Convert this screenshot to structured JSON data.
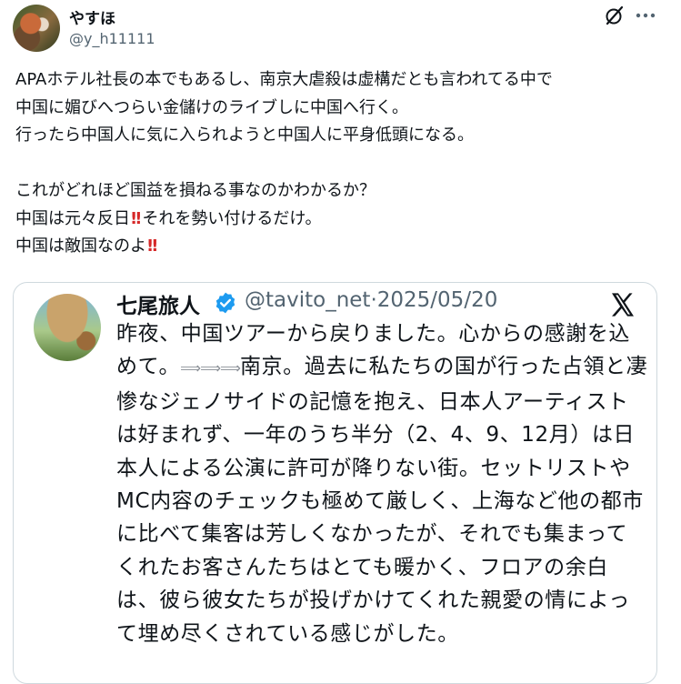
{
  "post": {
    "author_name": "やすほ",
    "author_handle": "@y_h11111",
    "text_line1": "APAホテル社長の本でもあるし、南京大虐殺は虚構だとも言われてる中で",
    "text_line2": "中国に媚びへつらい金儲けのライブしに中国へ行く。",
    "text_line3": "行ったら中国人に気に入られようと中国人に平身低頭になる。",
    "text_line4": "これがどれほど国益を損ねる事なのかわかるか？",
    "text_line5a": "中国は元々反日",
    "text_line5b": "それを勢い付けるだけ。",
    "text_line6": "中国は敵国なのよ",
    "emphasis_glyph": "!!",
    "icons": [
      "grok-icon",
      "more-icon"
    ]
  },
  "quote": {
    "author_name": "七尾旅人",
    "author_handle": "@tavito_net",
    "separator": "·",
    "date": "2025/05/20",
    "text_part1": "昨夜、中国ツアーから戻りました。心からの感謝を込めて。",
    "arrows": "⟹⟹⟹",
    "text_part2": "南京。過去に私たちの国が行った占領と凄惨なジェノサイドの記憶を抱え、日本人アーティストは好まれず、一年のうち半分（2、4、9、12月）は日本人による公演に許可が降りない街。セットリストやMC内容のチェックも極めて厳しく、上海など他の都市に比べて集客は芳しくなかったが、それでも集まってくれたお客さんたちはとても暖かく、フロアの余白は、彼ら彼女たちが投げかけてくれた親愛の情によって埋め尽くされている感じがした。",
    "icons": [
      "verified-icon",
      "x-logo-icon"
    ],
    "verified_color": "#1d9bf0"
  }
}
